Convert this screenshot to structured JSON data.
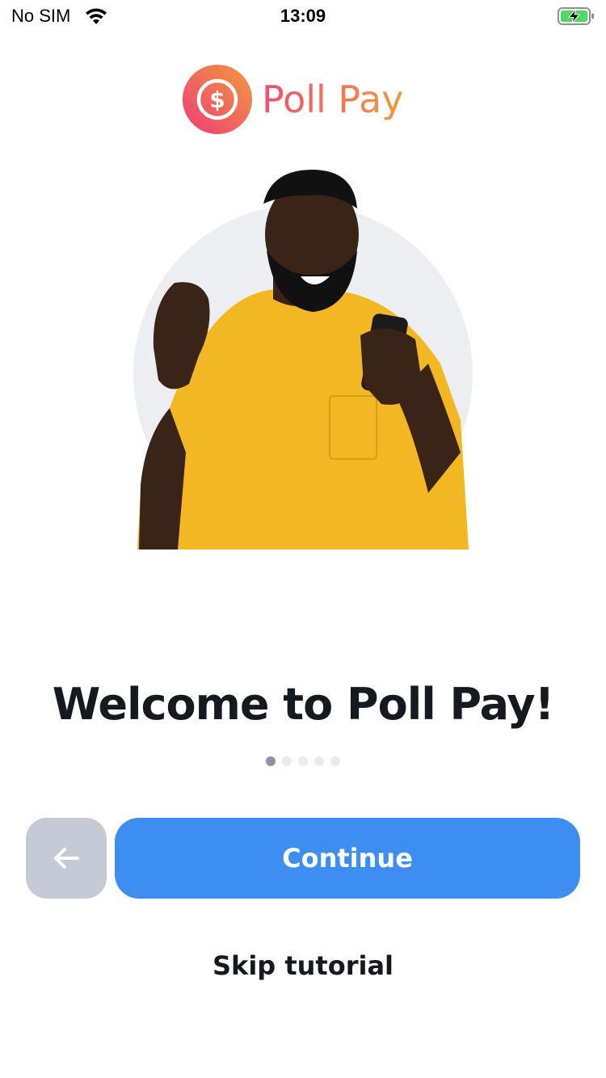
{
  "status_bar": {
    "carrier": "No SIM",
    "time": "13:09",
    "wifi_icon": "wifi-icon",
    "battery_icon": "battery-charging-icon",
    "battery_color": "#4cd964"
  },
  "brand": {
    "name": "Poll Pay",
    "logo_icon": "dollar-coin-icon",
    "gradient_start": "#ee4f73",
    "gradient_end": "#f39a3d"
  },
  "hero": {
    "image": "man-celebrating-with-phone-illustration",
    "circle_color": "#eceef2"
  },
  "onboarding": {
    "title": "Welcome to Poll Pay!",
    "page_count": 5,
    "current_page": 1
  },
  "actions": {
    "back_icon": "arrow-left-icon",
    "continue_label": "Continue",
    "skip_label": "Skip tutorial"
  },
  "colors": {
    "primary": "#3d8ef0",
    "back_button": "#c5cad6",
    "text": "#141a1f"
  }
}
